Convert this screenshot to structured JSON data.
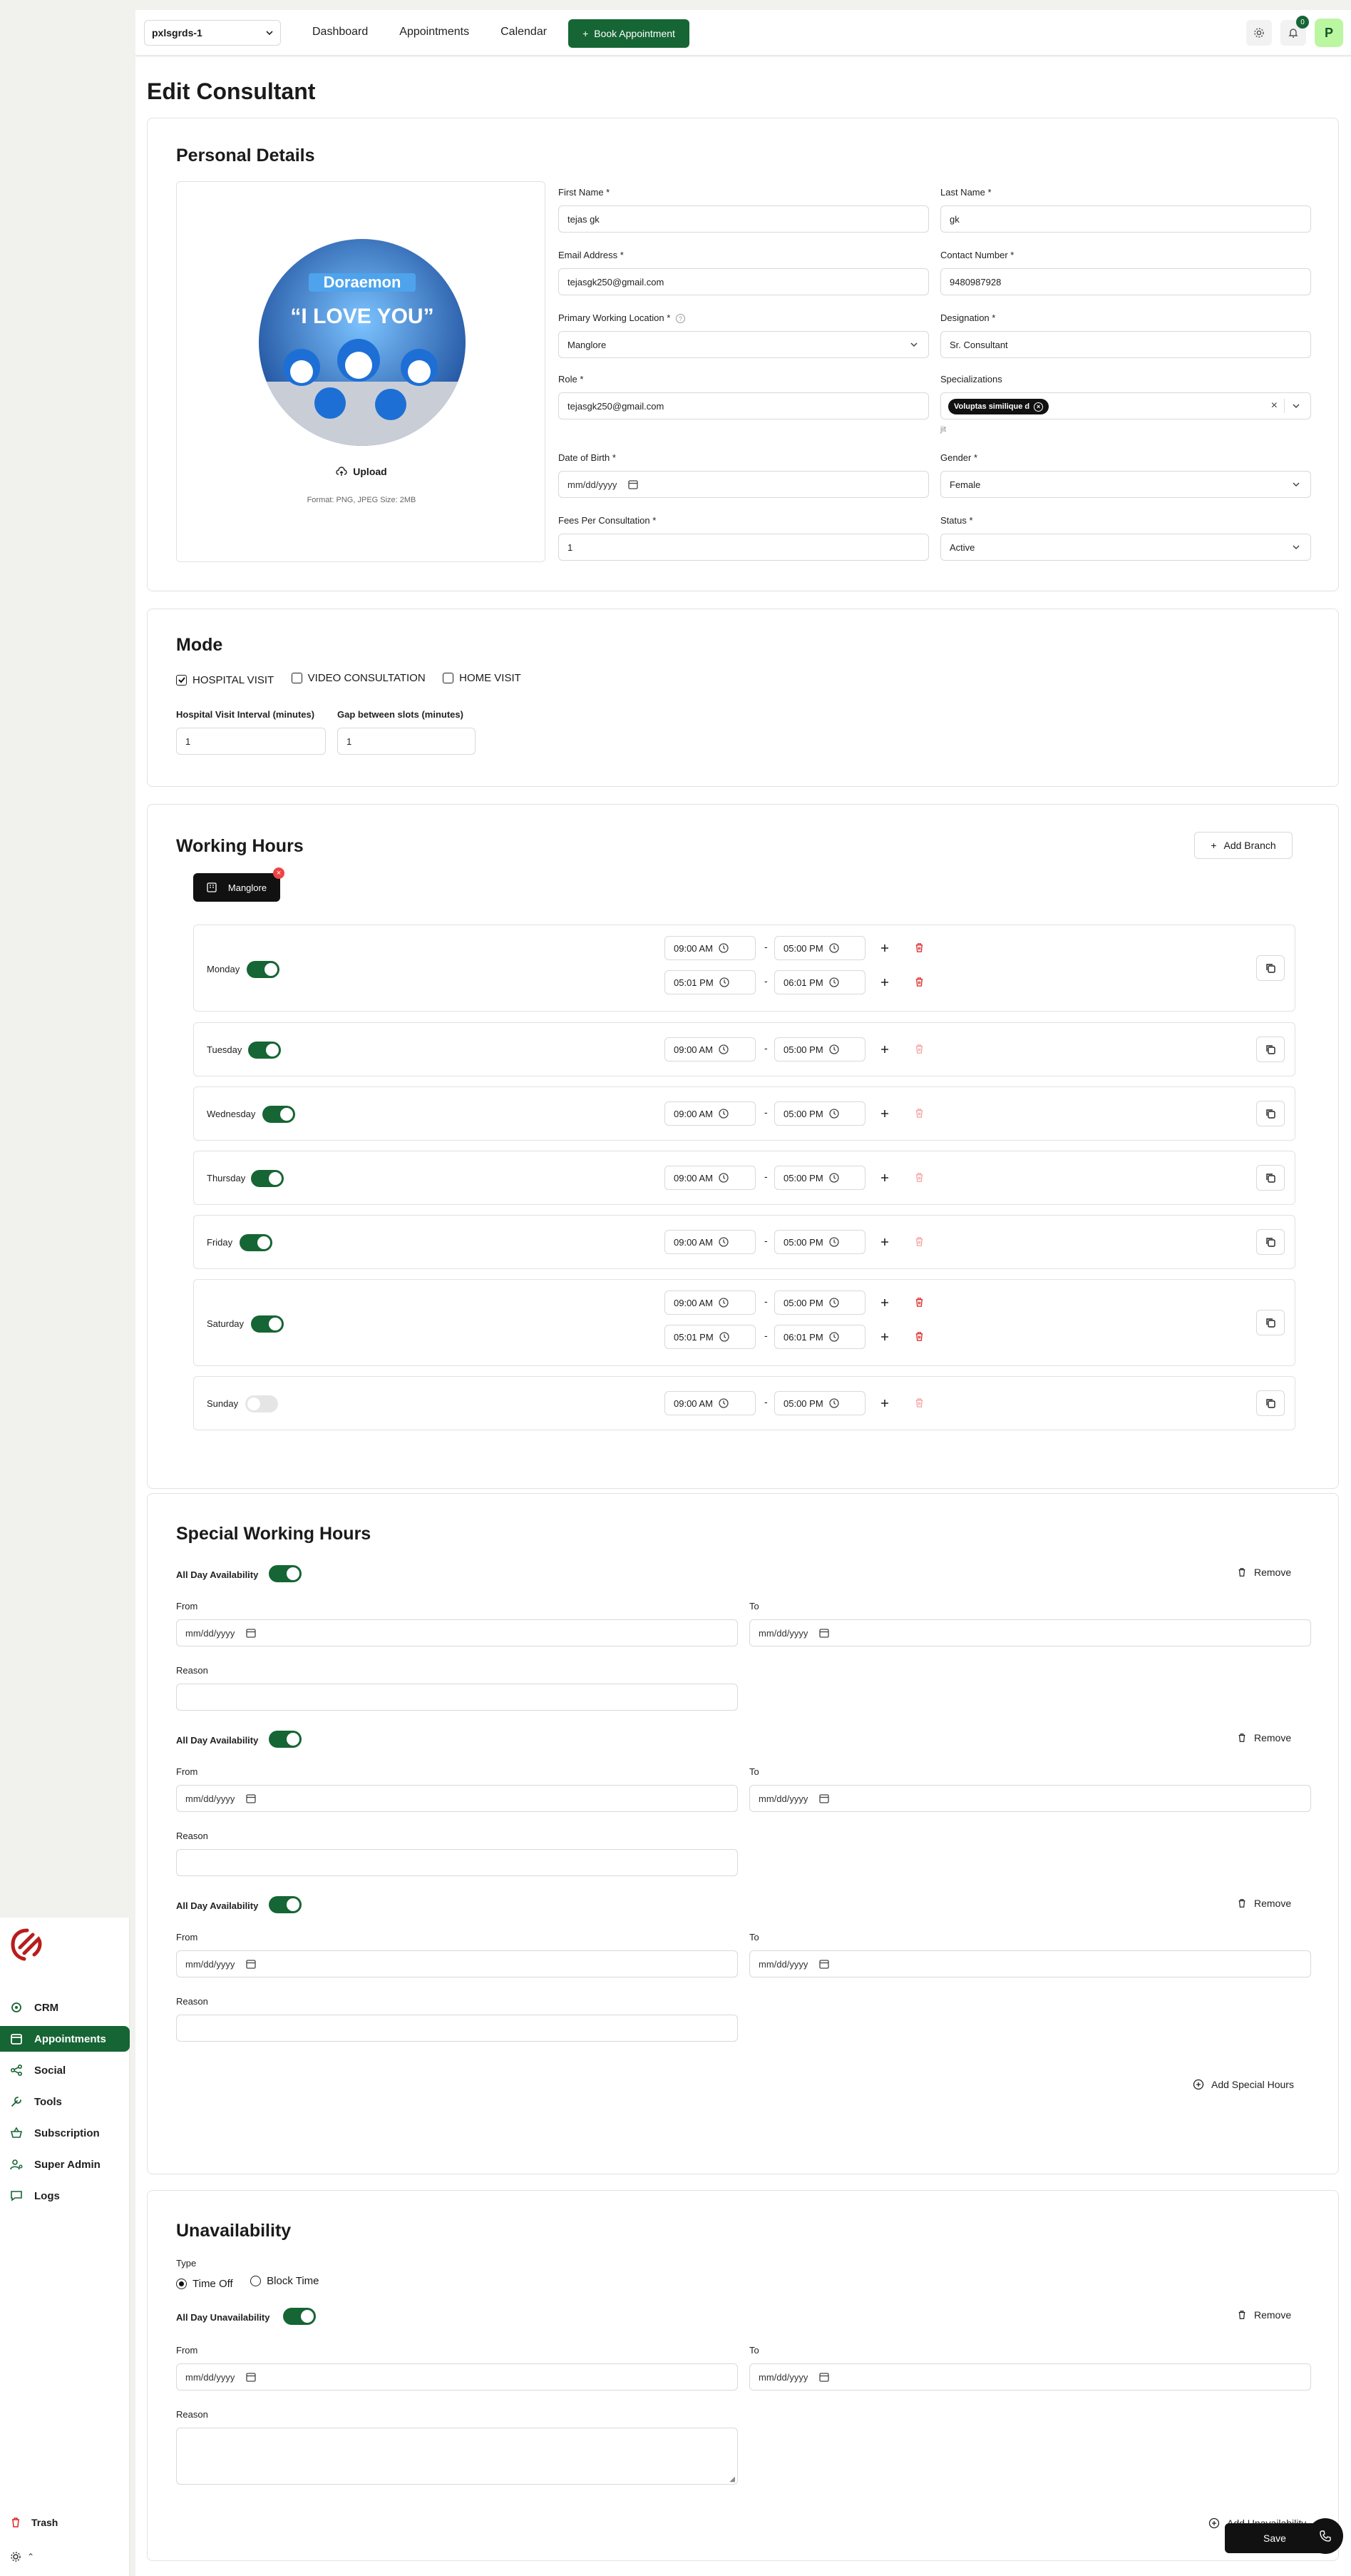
{
  "sidebar": {
    "items": [
      {
        "label": "CRM",
        "icon": "crm-icon"
      },
      {
        "label": "Appointments",
        "icon": "calendar-icon",
        "active": true
      },
      {
        "label": "Social",
        "icon": "share-icon"
      },
      {
        "label": "Tools",
        "icon": "wrench-icon"
      },
      {
        "label": "Subscription",
        "icon": "basket-icon"
      },
      {
        "label": "Super Admin",
        "icon": "user-cog-icon"
      },
      {
        "label": "Logs",
        "icon": "chat-icon"
      }
    ],
    "trash_label": "Trash"
  },
  "topbar": {
    "tenant": "pxlsgrds-1",
    "nav": [
      "Dashboard",
      "Appointments",
      "Calendar"
    ],
    "book_label": "Book Appointment",
    "notifications": "0",
    "avatar_initial": "P"
  },
  "page": {
    "title": "Edit Consultant"
  },
  "personal": {
    "title": "Personal Details",
    "upload_label": "Upload",
    "format_note": "Format: PNG, JPEG   Size: 2MB",
    "first_name": {
      "label": "First Name *",
      "value": "tejas gk"
    },
    "last_name": {
      "label": "Last Name *",
      "value": "gk"
    },
    "email": {
      "label": "Email Address *",
      "value": "tejasgk250@gmail.com"
    },
    "contact": {
      "label": "Contact Number *",
      "value": "9480987928"
    },
    "location": {
      "label": "Primary Working Location *",
      "value": "Manglore"
    },
    "designation": {
      "label": "Designation *",
      "value": "Sr. Consultant"
    },
    "role": {
      "label": "Role *",
      "value": "tejasgk250@gmail.com"
    },
    "specializations": {
      "label": "Specializations",
      "chip": "Voluptas similique d",
      "hint": "jit"
    },
    "dob": {
      "label": "Date of Birth *",
      "placeholder": "mm/dd/yyyy"
    },
    "gender": {
      "label": "Gender *",
      "value": "Female"
    },
    "fees": {
      "label": "Fees Per Consultation *",
      "value": "1"
    },
    "status": {
      "label": "Status *",
      "value": "Active"
    }
  },
  "mode": {
    "title": "Mode",
    "options": [
      {
        "label": "HOSPITAL VISIT",
        "checked": true
      },
      {
        "label": "VIDEO CONSULTATION",
        "checked": false
      },
      {
        "label": "HOME VISIT",
        "checked": false
      }
    ],
    "interval_label": "Hospital Visit Interval (minutes)",
    "interval_value": "1",
    "gap_label": "Gap between slots (minutes)",
    "gap_value": "1"
  },
  "working_hours": {
    "title": "Working Hours",
    "add_branch_label": "Add Branch",
    "branch": "Manglore",
    "days": [
      {
        "name": "Monday",
        "enabled": true,
        "slots": [
          [
            "09:00 AM",
            "05:00 PM"
          ],
          [
            "05:01 PM",
            "06:01 PM"
          ]
        ]
      },
      {
        "name": "Tuesday",
        "enabled": true,
        "slots": [
          [
            "09:00 AM",
            "05:00 PM"
          ]
        ]
      },
      {
        "name": "Wednesday",
        "enabled": true,
        "slots": [
          [
            "09:00 AM",
            "05:00 PM"
          ]
        ]
      },
      {
        "name": "Thursday",
        "enabled": true,
        "slots": [
          [
            "09:00 AM",
            "05:00 PM"
          ]
        ]
      },
      {
        "name": "Friday",
        "enabled": true,
        "slots": [
          [
            "09:00 AM",
            "05:00 PM"
          ]
        ]
      },
      {
        "name": "Saturday",
        "enabled": true,
        "slots": [
          [
            "09:00 AM",
            "05:00 PM"
          ],
          [
            "05:01 PM",
            "06:01 PM"
          ]
        ]
      },
      {
        "name": "Sunday",
        "enabled": false,
        "slots": [
          [
            "09:00 AM",
            "05:00 PM"
          ]
        ]
      }
    ]
  },
  "special": {
    "title": "Special Working Hours",
    "all_day_label": "All Day Availability",
    "remove_label": "Remove",
    "from_label": "From",
    "to_label": "To",
    "reason_label": "Reason",
    "date_placeholder": "mm/dd/yyyy",
    "add_label": "Add Special Hours"
  },
  "unavailability": {
    "title": "Unavailability",
    "type_label": "Type",
    "types": [
      {
        "label": "Time Off",
        "selected": true
      },
      {
        "label": "Block Time",
        "selected": false
      }
    ],
    "all_day_label": "All Day Unavailability",
    "remove_label": "Remove",
    "from_label": "From",
    "to_label": "To",
    "reason_label": "Reason",
    "date_placeholder": "mm/dd/yyyy",
    "add_label": "Add Unavailability"
  },
  "footer": {
    "save_label": "Save"
  },
  "colors": {
    "accent": "#166534",
    "danger": "#dc2626",
    "dark": "#111111"
  }
}
